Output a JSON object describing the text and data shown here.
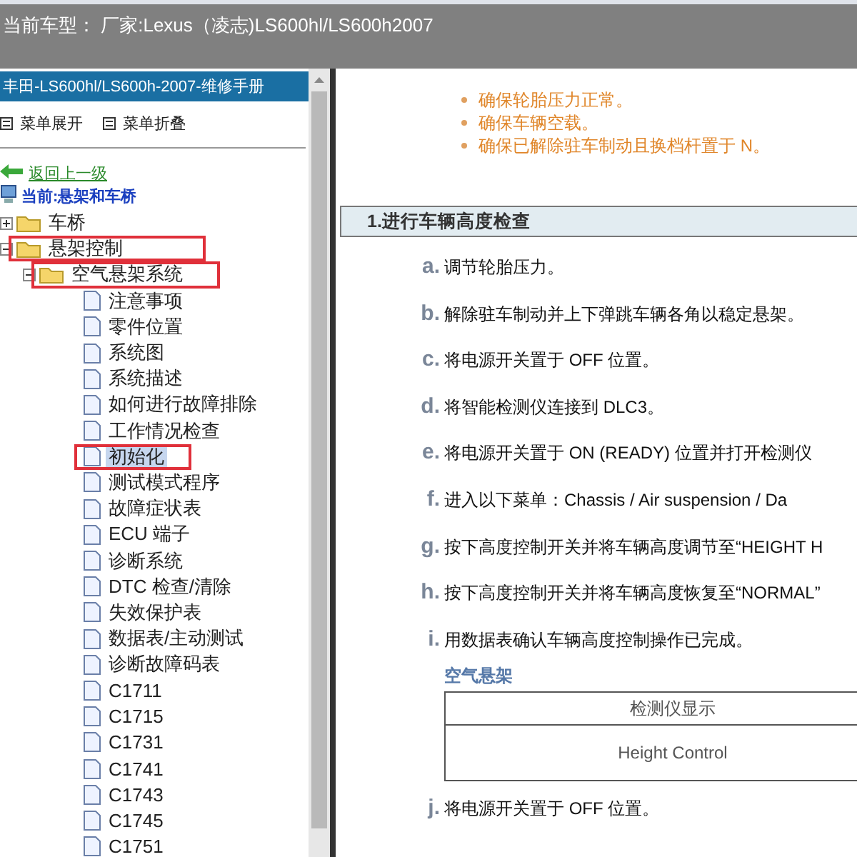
{
  "header": {
    "title": "当前车型： 厂家:Lexus（凌志)LS600hl/LS600h2007"
  },
  "sidebar": {
    "title": "丰田-LS600hl/LS600h-2007-维修手册",
    "menu_buttons": [
      {
        "label": "菜单展开"
      },
      {
        "label": "菜单折叠"
      }
    ],
    "back_link": "返回上一级",
    "current": "当前:悬架和车桥",
    "tree": [
      {
        "label": "车桥",
        "kind": "folder",
        "expanded": false,
        "selected": false,
        "annotated": false
      },
      {
        "label": "悬架控制",
        "kind": "folder",
        "expanded": true,
        "selected": false,
        "annotated": true,
        "children": [
          {
            "label": "空气悬架系统",
            "kind": "folder",
            "expanded": true,
            "selected": false,
            "annotated": true,
            "children": [
              {
                "label": "注意事项",
                "kind": "page",
                "selected": false,
                "annotated": false
              },
              {
                "label": "零件位置",
                "kind": "page",
                "selected": false,
                "annotated": false
              },
              {
                "label": "系统图",
                "kind": "page",
                "selected": false,
                "annotated": false
              },
              {
                "label": "系统描述",
                "kind": "page",
                "selected": false,
                "annotated": false
              },
              {
                "label": "如何进行故障排除",
                "kind": "page",
                "selected": false,
                "annotated": false
              },
              {
                "label": "工作情况检查",
                "kind": "page",
                "selected": false,
                "annotated": false
              },
              {
                "label": "初始化",
                "kind": "page",
                "selected": true,
                "annotated": true
              },
              {
                "label": "测试模式程序",
                "kind": "page",
                "selected": false,
                "annotated": false
              },
              {
                "label": "故障症状表",
                "kind": "page",
                "selected": false,
                "annotated": false
              },
              {
                "label": "ECU 端子",
                "kind": "page",
                "selected": false,
                "annotated": false
              },
              {
                "label": "诊断系统",
                "kind": "page",
                "selected": false,
                "annotated": false
              },
              {
                "label": "DTC 检查/清除",
                "kind": "page",
                "selected": false,
                "annotated": false
              },
              {
                "label": "失效保护表",
                "kind": "page",
                "selected": false,
                "annotated": false
              },
              {
                "label": "数据表/主动测试",
                "kind": "page",
                "selected": false,
                "annotated": false
              },
              {
                "label": "诊断故障码表",
                "kind": "page",
                "selected": false,
                "annotated": false
              },
              {
                "label": "C1711",
                "kind": "page",
                "selected": false,
                "annotated": false
              },
              {
                "label": "C1715",
                "kind": "page",
                "selected": false,
                "annotated": false
              },
              {
                "label": "C1731",
                "kind": "page",
                "selected": false,
                "annotated": false
              },
              {
                "label": "C1741",
                "kind": "page",
                "selected": false,
                "annotated": false
              },
              {
                "label": "C1743",
                "kind": "page",
                "selected": false,
                "annotated": false
              },
              {
                "label": "C1745",
                "kind": "page",
                "selected": false,
                "annotated": false
              },
              {
                "label": "C1751",
                "kind": "page",
                "selected": false,
                "annotated": false
              }
            ]
          }
        ]
      }
    ]
  },
  "content": {
    "notes": [
      "确保轮胎压力正常。",
      "确保车辆空载。",
      "确保已解除驻车制动且换档杆置于 N。"
    ],
    "section_heading": "1.进行车辆高度检查",
    "steps": [
      {
        "letter": "a.",
        "text": "调节轮胎压力。"
      },
      {
        "letter": "b.",
        "text": "解除驻车制动并上下弹跳车辆各角以稳定悬架。"
      },
      {
        "letter": "c.",
        "text": "将电源开关置于 OFF 位置。"
      },
      {
        "letter": "d.",
        "text": "将智能检测仪连接到 DLC3。"
      },
      {
        "letter": "e.",
        "text": "将电源开关置于 ON (READY) 位置并打开检测仪"
      },
      {
        "letter": "f.",
        "text": "进入以下菜单：Chassis / Air suspension / Da"
      },
      {
        "letter": "g.",
        "text": "按下高度控制开关并将车辆高度调节至“HEIGHT H"
      },
      {
        "letter": "h.",
        "text": "按下高度控制开关并将车辆高度恢复至“NORMAL”"
      },
      {
        "letter": "i.",
        "text": "用数据表确认车辆高度控制操作已完成。",
        "table": {
          "caption": "空气悬架",
          "header": "检测仪显示",
          "cell": "Height Control"
        }
      },
      {
        "letter": "j.",
        "text": "将电源开关置于 OFF 位置。"
      }
    ]
  }
}
